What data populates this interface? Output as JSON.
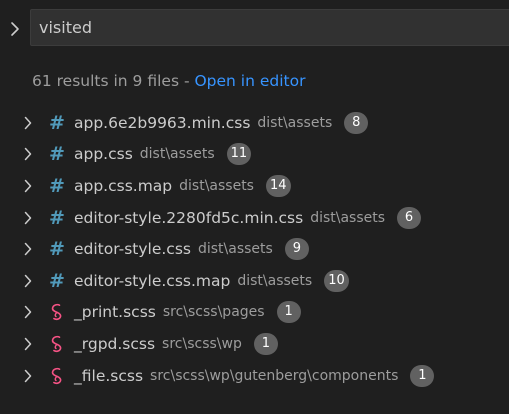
{
  "search": {
    "value": "visited",
    "toggle_icon": "chevron-right-icon"
  },
  "summary": {
    "count_text": "61 results in 9 files",
    "separator": " - ",
    "open_in_editor": "Open in editor"
  },
  "colors": {
    "css_icon": "#519aba",
    "scss_icon": "#f55385",
    "link": "#3794ff",
    "badge_bg": "#616161"
  },
  "results": [
    {
      "icon": "css-hash-icon",
      "name": "app.6e2b9963.min.css",
      "path": "dist\\assets",
      "count": "8"
    },
    {
      "icon": "css-hash-icon",
      "name": "app.css",
      "path": "dist\\assets",
      "count": "11"
    },
    {
      "icon": "css-hash-icon",
      "name": "app.css.map",
      "path": "dist\\assets",
      "count": "14"
    },
    {
      "icon": "css-hash-icon",
      "name": "editor-style.2280fd5c.min.css",
      "path": "dist\\assets",
      "count": "6"
    },
    {
      "icon": "css-hash-icon",
      "name": "editor-style.css",
      "path": "dist\\assets",
      "count": "9"
    },
    {
      "icon": "css-hash-icon",
      "name": "editor-style.css.map",
      "path": "dist\\assets",
      "count": "10"
    },
    {
      "icon": "sass-icon",
      "name": "_print.scss",
      "path": "src\\scss\\pages",
      "count": "1"
    },
    {
      "icon": "sass-icon",
      "name": "_rgpd.scss",
      "path": "src\\scss\\wp",
      "count": "1"
    },
    {
      "icon": "sass-icon",
      "name": "_file.scss",
      "path": "src\\scss\\wp\\gutenberg\\components",
      "count": "1"
    }
  ]
}
